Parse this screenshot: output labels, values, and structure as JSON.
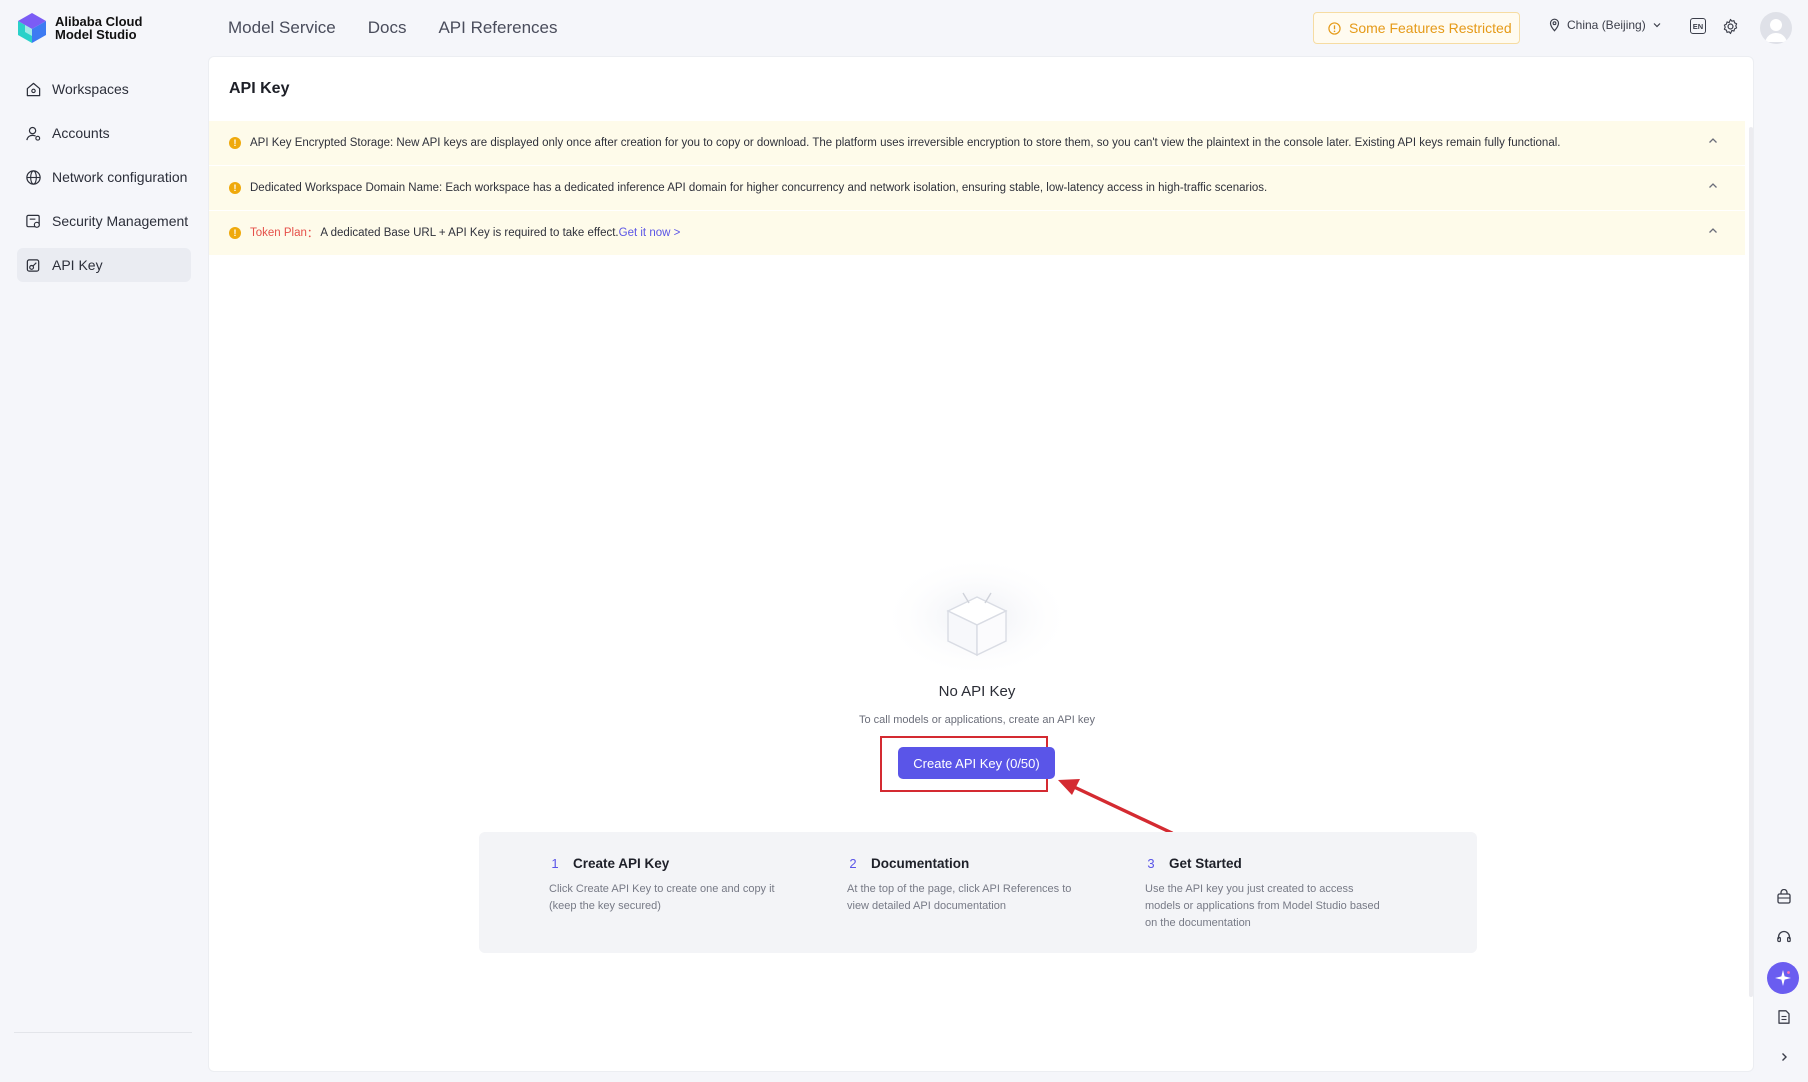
{
  "brand": {
    "line1": "Alibaba Cloud",
    "line2": "Model Studio"
  },
  "topnav": [
    "Model Service",
    "Docs",
    "API References"
  ],
  "header": {
    "restricted_label": "Some Features Restricted",
    "region": "China (Beijing)",
    "lang_badge": "EN"
  },
  "sidebar": {
    "items": [
      {
        "label": "Workspaces",
        "icon": "home-icon"
      },
      {
        "label": "Accounts",
        "icon": "user-icon"
      },
      {
        "label": "Network configuration",
        "icon": "globe-icon"
      },
      {
        "label": "Security Management",
        "icon": "security-icon"
      },
      {
        "label": "API Key",
        "icon": "key-icon",
        "active": true
      }
    ]
  },
  "page": {
    "title": "API Key",
    "notices": [
      {
        "text": "API Key Encrypted Storage: New API keys are displayed only once after creation for you to copy or download. The platform uses irreversible encryption to store them, so you can't view the plaintext in the console later. Existing API keys remain fully functional."
      },
      {
        "text": "Dedicated Workspace Domain Name: Each workspace has a dedicated inference API domain for higher concurrency and network isolation, ensuring stable, low-latency access in high-traffic scenarios."
      },
      {
        "label": "Token Plan",
        "separator": "：",
        "text": "A dedicated Base URL + API Key is required to take effect.",
        "link": "Get it now >"
      }
    ],
    "empty_state": {
      "title": "No API Key",
      "subtitle": "To call models or applications, create an API key",
      "button": "Create API Key (0/50)"
    },
    "steps": [
      {
        "num": "1",
        "title": "Create API Key",
        "desc": "Click Create API Key to create one and copy it (keep the key secured)"
      },
      {
        "num": "2",
        "title": "Documentation",
        "desc": "At the top of the page, click API References to view detailed API documentation"
      },
      {
        "num": "3",
        "title": "Get Started",
        "desc": "Use the API key you just created to access models or applications from Model Studio based on the documentation"
      }
    ]
  },
  "colors": {
    "primary": "#5a55e8",
    "warning": "#efa90c",
    "notice_bg": "#fefbea",
    "annotation_red": "#d42a31"
  }
}
